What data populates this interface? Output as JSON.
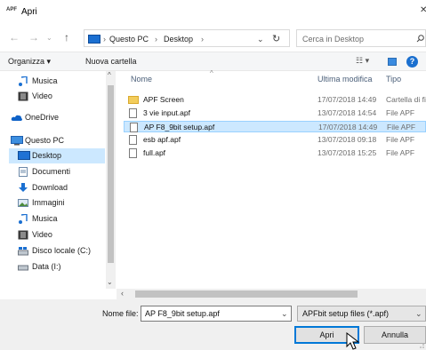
{
  "window": {
    "title": "Apri",
    "app_icon_text": "APF"
  },
  "address": {
    "crumbs": [
      "Questo PC",
      "Desktop"
    ],
    "search_placeholder": "Cerca in Desktop"
  },
  "toolbar": {
    "organize_label": "Organizza ▾",
    "new_folder_label": "Nuova cartella"
  },
  "sidebar": {
    "items": [
      {
        "label": "Musica",
        "icon": "music-icon"
      },
      {
        "label": "Video",
        "icon": "video-icon"
      },
      {
        "label": "OneDrive",
        "icon": "cloud-icon"
      },
      {
        "label": "Questo PC",
        "icon": "computer-icon"
      },
      {
        "label": "Desktop",
        "icon": "desktop-icon",
        "selected": true
      },
      {
        "label": "Documenti",
        "icon": "documents-icon"
      },
      {
        "label": "Download",
        "icon": "download-icon"
      },
      {
        "label": "Immagini",
        "icon": "pictures-icon"
      },
      {
        "label": "Musica",
        "icon": "music-icon"
      },
      {
        "label": "Video",
        "icon": "video-icon"
      },
      {
        "label": "Disco locale (C:)",
        "icon": "drive-icon"
      },
      {
        "label": "Data (I:)",
        "icon": "drive-icon"
      }
    ]
  },
  "list": {
    "headers": {
      "name": "Nome",
      "modified": "Ultima modifica",
      "type": "Tipo"
    },
    "rows": [
      {
        "name": "APF Screen",
        "modified": "17/07/2018 14:49",
        "type": "Cartella di file",
        "kind": "folder"
      },
      {
        "name": "3 vie input.apf",
        "modified": "13/07/2018 14:54",
        "type": "File APF",
        "kind": "file"
      },
      {
        "name": "AP F8_9bit setup.apf",
        "modified": "17/07/2018 14:49",
        "type": "File APF",
        "kind": "file",
        "selected": true
      },
      {
        "name": "esb apf.apf",
        "modified": "13/07/2018 09:18",
        "type": "File APF",
        "kind": "file"
      },
      {
        "name": "full.apf",
        "modified": "13/07/2018 15:25",
        "type": "File APF",
        "kind": "file"
      }
    ]
  },
  "bottom": {
    "filename_label": "Nome file:",
    "filename_value": "AP F8_9bit setup.apf",
    "filter_value": "APFbit setup files (*.apf)",
    "open_label": "Apri",
    "cancel_label": "Annulla"
  },
  "colors": {
    "accent": "#0078d7",
    "selection": "#cce8ff",
    "folder": "#f3cd5c"
  }
}
